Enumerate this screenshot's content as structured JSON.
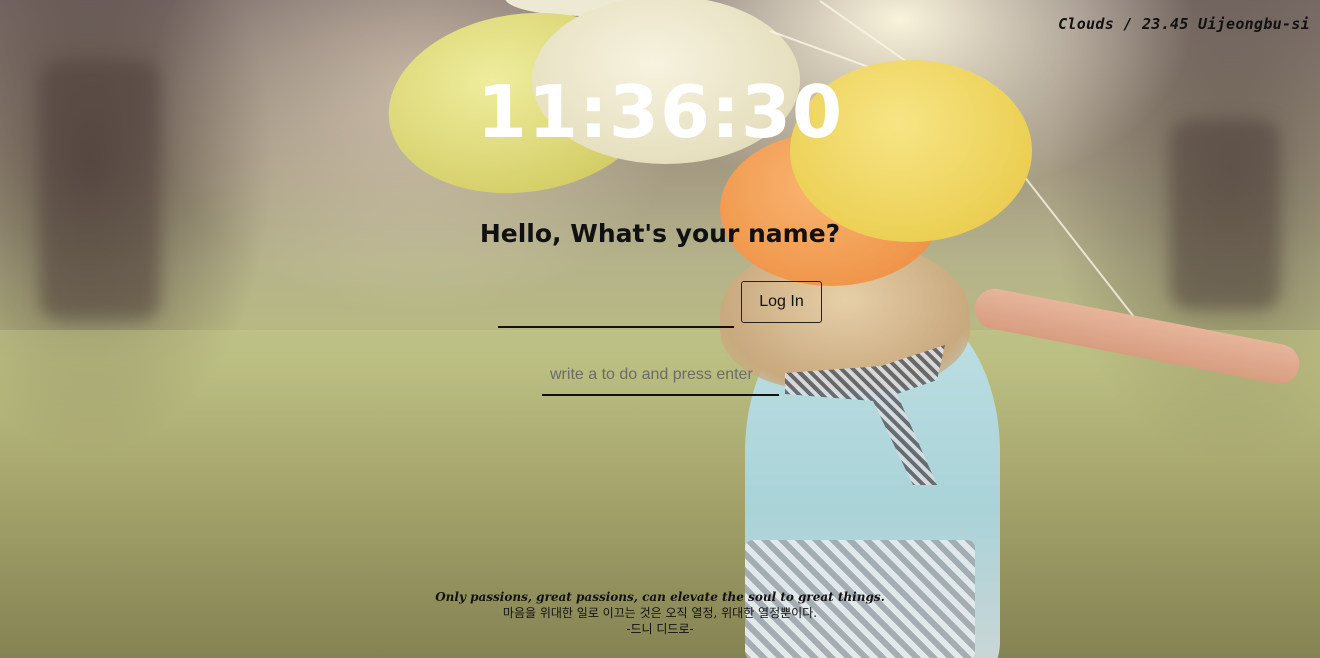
{
  "weather": {
    "text": "Clouds / 23.45 Uijeongbu-si"
  },
  "clock": {
    "time": "11:36:30"
  },
  "greeting": {
    "text": "Hello, What's your name?"
  },
  "login_form": {
    "name_value": "",
    "name_placeholder": "",
    "button_label": "Log In"
  },
  "todo": {
    "placeholder": "write a to do and press enter",
    "value": ""
  },
  "quote": {
    "english": "Only passions, great passions, can elevate the soul to great things.",
    "korean": "마음을 위대한 일로 이끄는 것은 오직 열정, 위대한 열정뿐이다.",
    "author": "-드니 디드로-"
  }
}
